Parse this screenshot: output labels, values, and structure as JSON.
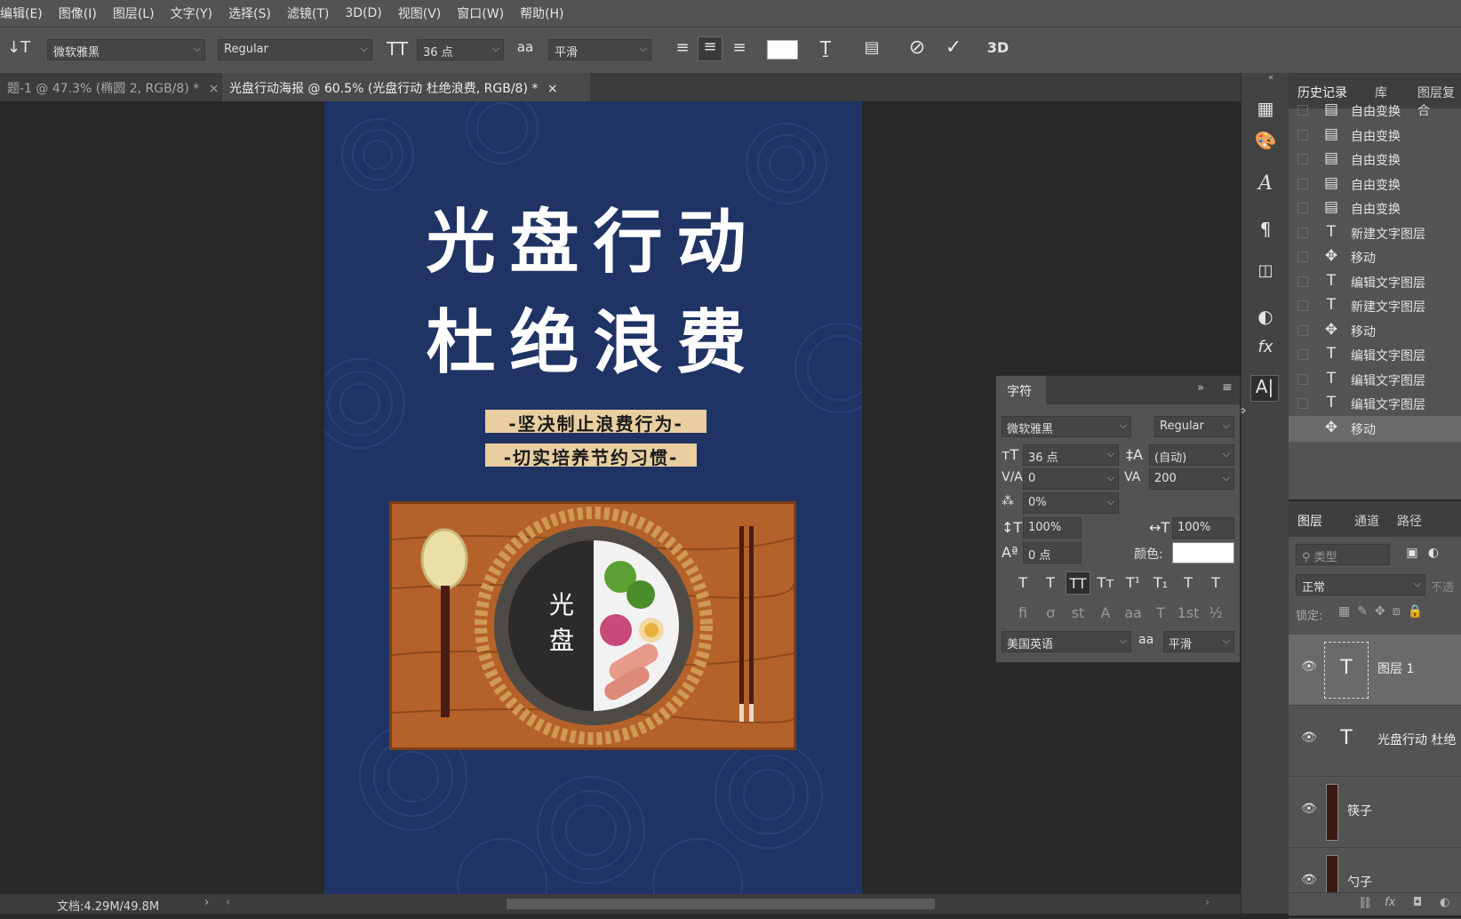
{
  "menu": [
    "编辑(E)",
    "图像(I)",
    "图层(L)",
    "文字(Y)",
    "选择(S)",
    "滤镜(T)",
    "3D(D)",
    "视图(V)",
    "窗口(W)",
    "帮助(H)"
  ],
  "options": {
    "font_family": "微软雅黑",
    "font_style": "Regular",
    "font_size": "36 点",
    "antialias_icon": "aa",
    "antialias": "平滑",
    "color": "#ffffff",
    "three_d": "3D"
  },
  "tabs": [
    {
      "label": "题-1 @ 47.3% (椭圆 2, RGB/8) *",
      "close": "×"
    },
    {
      "label": "光盘行动海报 @ 60.5% (光盘行动 杜绝浪费, RGB/8) *",
      "close": "×"
    }
  ],
  "poster": {
    "title_line1": "光盘行动",
    "title_line2": "杜绝浪费",
    "sub_line1": "-坚决制止浪费行为-",
    "sub_line2": "-切实培养节约习惯-",
    "plate_line1": "光",
    "plate_line2": "盘",
    "bg_color": "#1f3464",
    "board_color": "#b5622a"
  },
  "status": {
    "doc": "文档:4.29M/49.8M"
  },
  "history": {
    "tabs": [
      "历史记录",
      "库",
      "图层复合"
    ],
    "items": [
      {
        "icon": "doc",
        "label": "自由变换"
      },
      {
        "icon": "doc",
        "label": "自由变换"
      },
      {
        "icon": "doc",
        "label": "自由变换"
      },
      {
        "icon": "doc",
        "label": "自由变换"
      },
      {
        "icon": "doc",
        "label": "自由变换"
      },
      {
        "icon": "text",
        "label": "新建文字图层"
      },
      {
        "icon": "move",
        "label": "移动"
      },
      {
        "icon": "text",
        "label": "编辑文字图层"
      },
      {
        "icon": "text",
        "label": "新建文字图层"
      },
      {
        "icon": "move",
        "label": "移动"
      },
      {
        "icon": "text",
        "label": "编辑文字图层"
      },
      {
        "icon": "text",
        "label": "编辑文字图层"
      },
      {
        "icon": "text",
        "label": "编辑文字图层"
      },
      {
        "icon": "move",
        "label": "移动"
      }
    ]
  },
  "layers": {
    "tabs": [
      "图层",
      "通道",
      "路径"
    ],
    "filter_placeholder": "类型",
    "blend_mode": "正常",
    "opacity_label": "不透",
    "lock_label": "锁定:",
    "items": [
      {
        "name": "图层 1",
        "type": "text"
      },
      {
        "name": "光盘行动 杜绝",
        "type": "text"
      },
      {
        "name": "筷子",
        "type": "image"
      },
      {
        "name": "勺子",
        "type": "image"
      }
    ]
  },
  "character": {
    "title": "字符",
    "font_family": "微软雅黑",
    "font_style": "Regular",
    "size": "36 点",
    "leading": "(自动)",
    "kerning": "0",
    "tracking": "200",
    "tsume": "0%",
    "v_scale": "100%",
    "h_scale": "100%",
    "baseline": "0 点",
    "color_label": "颜色:",
    "language": "美国英语",
    "aa_icon": "aa",
    "antialias": "平滑",
    "style_buttons": [
      "T",
      "T",
      "TT",
      "Tт",
      "T¹",
      "T₁",
      "T",
      "T"
    ],
    "ot_buttons": [
      "ﬁ",
      "ơ",
      "st",
      "A",
      "aa",
      "T",
      "1st",
      "½"
    ]
  }
}
